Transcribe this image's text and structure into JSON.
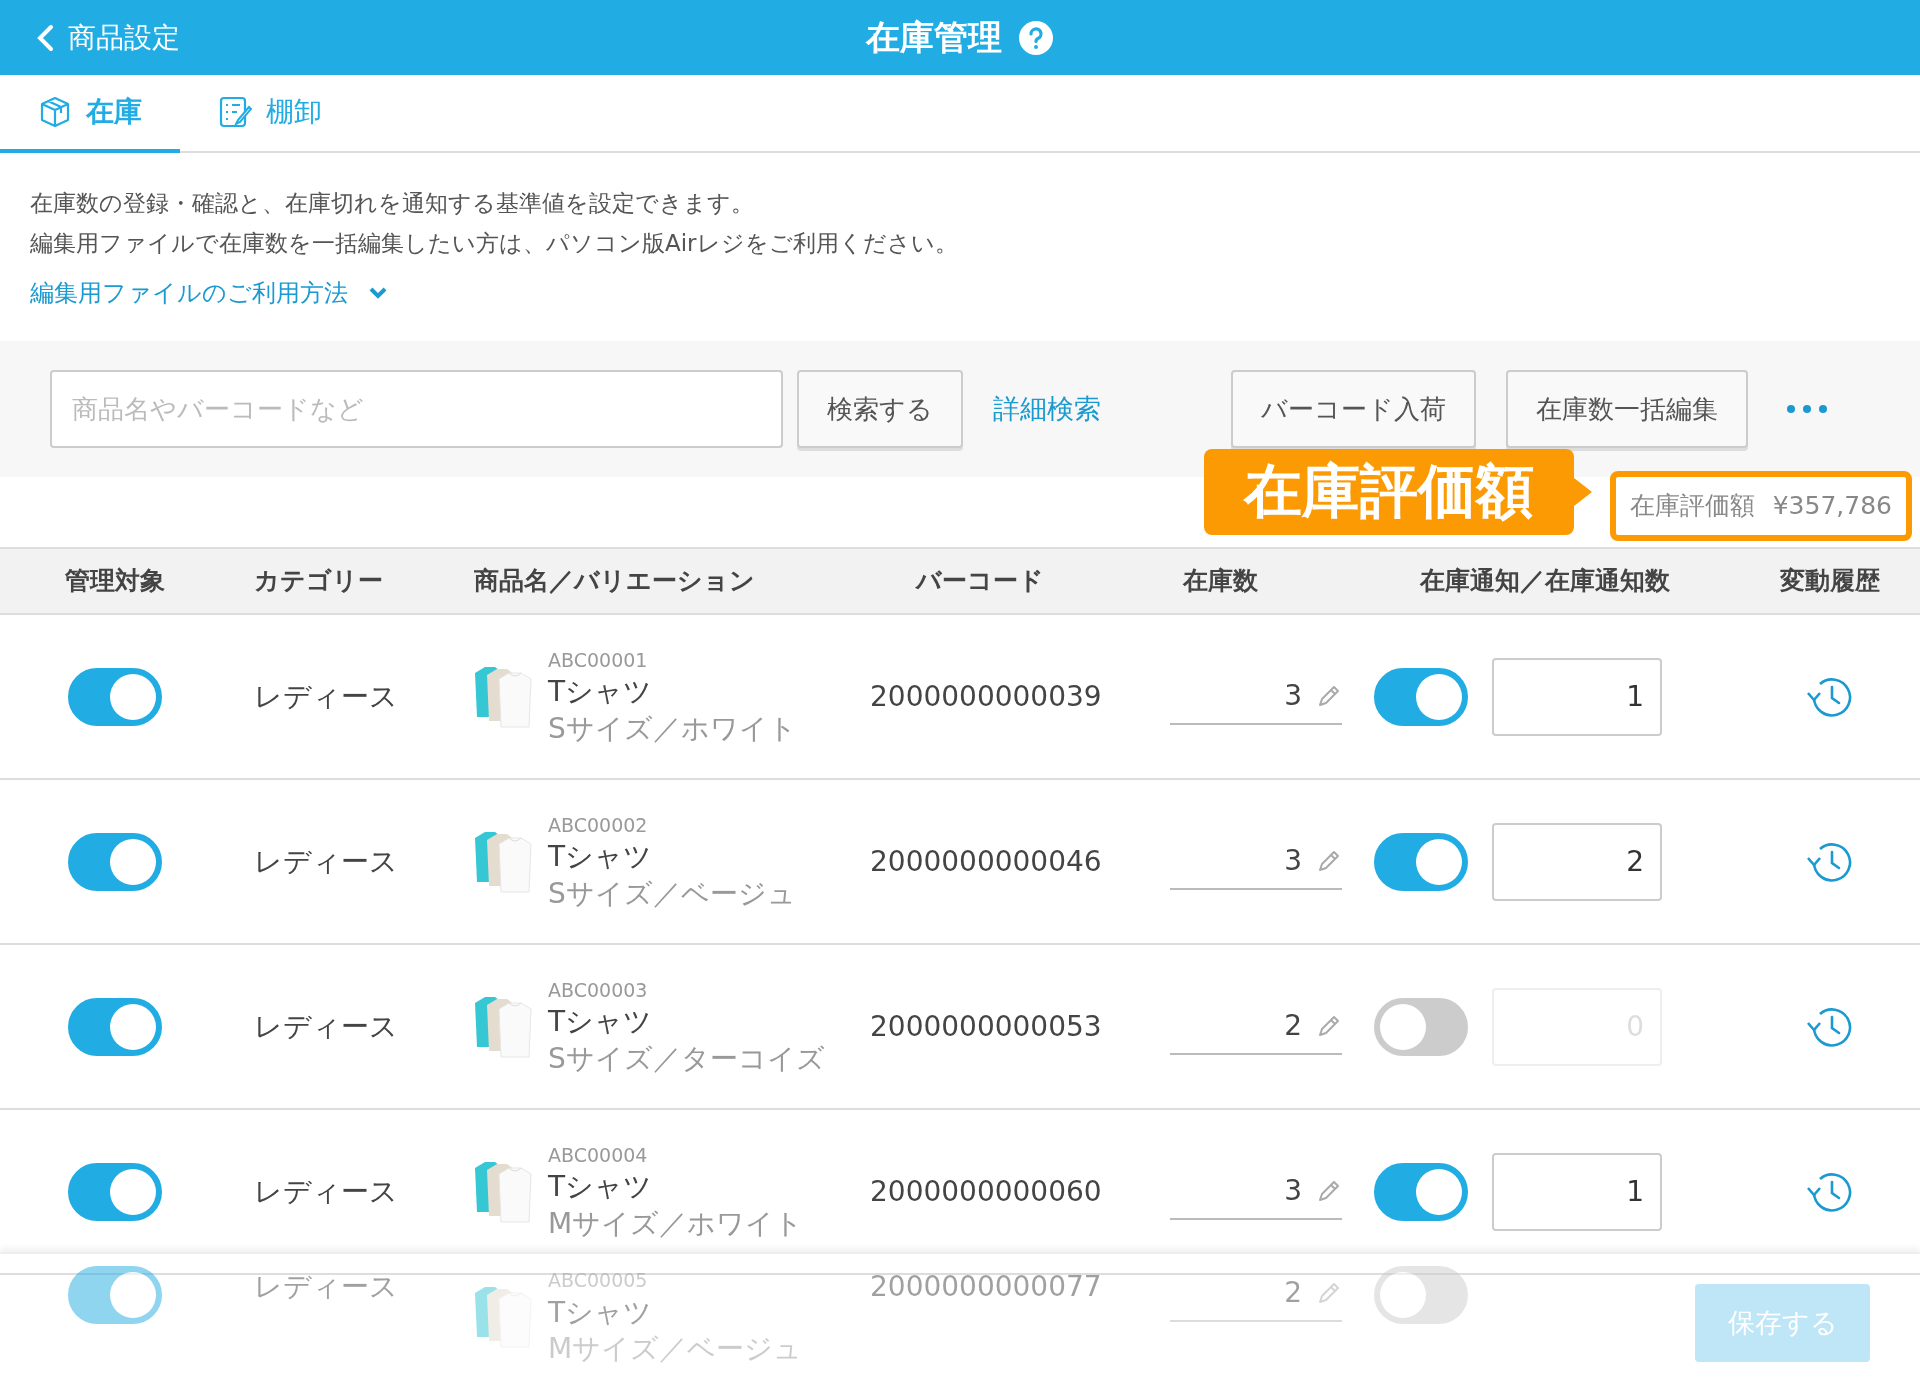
{
  "header": {
    "back_label": "商品設定",
    "title": "在庫管理"
  },
  "tabs": [
    {
      "label": "在庫",
      "kind": "box",
      "selected": true
    },
    {
      "label": "棚卸",
      "kind": "checklist",
      "selected": false
    }
  ],
  "description": [
    "在庫数の登録・確認と、在庫切れを通知する基準値を設定できます。",
    "編集用ファイルで在庫数を一括編集したい方は、パソコン版Airレジをご利用ください。"
  ],
  "help_link": "編集用ファイルのご利用方法",
  "search": {
    "placeholder": "商品名やバーコードなど",
    "button": "検索する",
    "advanced": "詳細検索"
  },
  "actions": [
    "バーコード入荷",
    "在庫数一括編集"
  ],
  "callout": "在庫評価額",
  "valuation": {
    "label": "在庫評価額",
    "value": "¥357,786"
  },
  "columns": [
    "管理対象",
    "カテゴリー",
    "商品名／バリエーション",
    "バーコード",
    "在庫数",
    "在庫通知／在庫通知数",
    "変動履歴"
  ],
  "rows": [
    {
      "managed": true,
      "category": "レディース",
      "code": "ABC00001",
      "name": "Tシャツ",
      "variation": "Sサイズ／ホワイト",
      "barcode": "2000000000039",
      "stock": "3",
      "notify": true,
      "notify_count": "1"
    },
    {
      "managed": true,
      "category": "レディース",
      "code": "ABC00002",
      "name": "Tシャツ",
      "variation": "Sサイズ／ベージュ",
      "barcode": "2000000000046",
      "stock": "3",
      "notify": true,
      "notify_count": "2"
    },
    {
      "managed": true,
      "category": "レディース",
      "code": "ABC00003",
      "name": "Tシャツ",
      "variation": "Sサイズ／ターコイズ",
      "barcode": "2000000000053",
      "stock": "2",
      "notify": false,
      "notify_count": "0"
    },
    {
      "managed": true,
      "category": "レディース",
      "code": "ABC00004",
      "name": "Tシャツ",
      "variation": "Mサイズ／ホワイト",
      "barcode": "2000000000060",
      "stock": "3",
      "notify": true,
      "notify_count": "1"
    },
    {
      "managed": true,
      "category": "レディース",
      "code": "ABC00005",
      "name": "Tシャツ",
      "variation": "Mサイズ／ベージュ",
      "barcode": "2000000000077",
      "stock": "2",
      "notify": false
    }
  ],
  "save_button": {
    "label": "保存する",
    "disabled": true
  }
}
